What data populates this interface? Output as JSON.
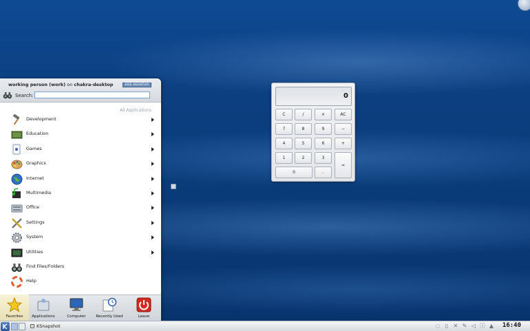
{
  "menu": {
    "user_name": "working person (work)",
    "user_on": "on",
    "host": "chakra-desktop",
    "kde_badge": "KDE DESKTOP",
    "search_label": "Search:",
    "search_value": "",
    "breadcrumb": "All Applications",
    "items": [
      {
        "label": "Development",
        "icon": "hammer-icon",
        "arrow": true
      },
      {
        "label": "Education",
        "icon": "education-icon",
        "arrow": true
      },
      {
        "label": "Games",
        "icon": "games-icon",
        "arrow": true
      },
      {
        "label": "Graphics",
        "icon": "palette-icon",
        "arrow": true
      },
      {
        "label": "Internet",
        "icon": "globe-icon",
        "arrow": true
      },
      {
        "label": "Multimedia",
        "icon": "multimedia-icon",
        "arrow": true
      },
      {
        "label": "Office",
        "icon": "office-icon",
        "arrow": true
      },
      {
        "label": "Settings",
        "icon": "settings-icon",
        "arrow": true
      },
      {
        "label": "System",
        "icon": "system-icon",
        "arrow": true
      },
      {
        "label": "Utilities",
        "icon": "utilities-icon",
        "arrow": true
      },
      {
        "label": "Find Files/Folders",
        "icon": "binoculars-icon",
        "arrow": false
      },
      {
        "label": "Help",
        "icon": "help-icon",
        "arrow": false
      }
    ],
    "tabs": [
      {
        "label": "Favorites",
        "icon": "star-icon"
      },
      {
        "label": "Applications",
        "icon": "applications-icon"
      },
      {
        "label": "Computer",
        "icon": "computer-icon"
      },
      {
        "label": "Recently Used",
        "icon": "clock-icon"
      },
      {
        "label": "Leave",
        "icon": "power-icon"
      }
    ]
  },
  "calculator": {
    "display": "0",
    "buttons": [
      "C",
      "/",
      "×",
      "AC",
      "7",
      "8",
      "9",
      "−",
      "4",
      "5",
      "6",
      "+",
      "1",
      "2",
      "3",
      "=",
      "0",
      "."
    ]
  },
  "taskbar": {
    "task_label": "KSnapshot",
    "clock": "16:40"
  }
}
